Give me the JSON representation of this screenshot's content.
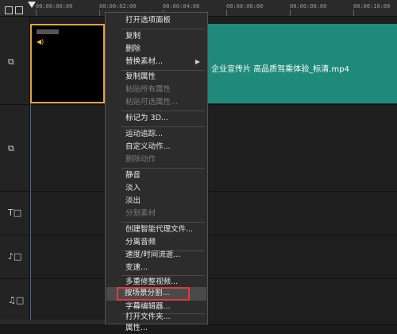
{
  "ruler": {
    "times": [
      "00:00:00:00",
      "00:00:02:00",
      "00:00:04:00",
      "00:00:06:00",
      "00:00:08:00",
      "00:00:10:00"
    ]
  },
  "clip": {
    "title": "企业宣传片 高品质驾乘体验_标清.mp4"
  },
  "menu": {
    "items": [
      {
        "label": "打开选项面板",
        "disabled": false
      },
      {
        "label": "复制",
        "disabled": false
      },
      {
        "label": "删除",
        "disabled": false
      },
      {
        "label": "替换素材...",
        "disabled": false,
        "submenu": true
      },
      {
        "label": "复制属性",
        "disabled": false
      },
      {
        "label": "粘贴所有属性",
        "disabled": true
      },
      {
        "label": "粘贴可选属性...",
        "disabled": true
      },
      {
        "label": "标记为 3D...",
        "disabled": false
      },
      {
        "label": "运动追踪...",
        "disabled": false
      },
      {
        "label": "自定义动作...",
        "disabled": false
      },
      {
        "label": "删除动作",
        "disabled": true
      },
      {
        "label": "静音",
        "disabled": false
      },
      {
        "label": "淡入",
        "disabled": false
      },
      {
        "label": "淡出",
        "disabled": false
      },
      {
        "label": "分割素材",
        "disabled": true
      },
      {
        "label": "创建智能代理文件...",
        "disabled": false
      },
      {
        "label": "分离音频",
        "disabled": false
      },
      {
        "label": "速度/时间流逝...",
        "disabled": false
      },
      {
        "label": "变速...",
        "disabled": false
      },
      {
        "label": "多重修整视频...",
        "disabled": false
      },
      {
        "label": "按场景分割...",
        "disabled": false,
        "highlighted": true
      },
      {
        "label": "字幕编辑器...",
        "disabled": false
      },
      {
        "label": "打开文件夹...",
        "disabled": false
      },
      {
        "label": "属性...",
        "disabled": false
      }
    ]
  },
  "track_icons": [
    "video-track-icon",
    "overlay-track-icon",
    "title-track-icon",
    "voice-track-icon",
    "music-track-icon"
  ],
  "colors": {
    "clip": "#1f8a7a",
    "selection_border": "#e6a23c",
    "highlight_box": "#e23b3b"
  }
}
